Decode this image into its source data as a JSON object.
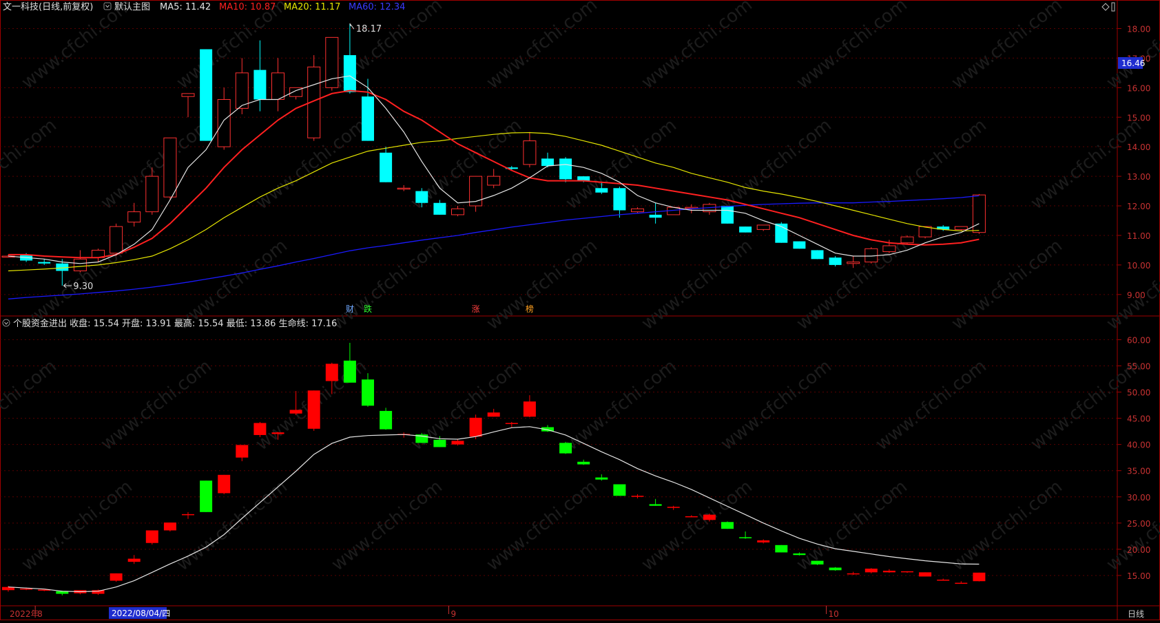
{
  "upper": {
    "stock_title": "文一科技(日线,前复权)",
    "indicator_name": "默认主图",
    "ma5_label": "MA5: 11.42",
    "ma10_label": "MA10: 10.87",
    "ma20_label": "MA20: 11.17",
    "ma60_label": "MA60: 12.34",
    "current_price_tag": "16.46",
    "high_label": "18.17",
    "low_label": "9.30",
    "diamond_icon": "diamond-icon",
    "colors": {
      "ma5": "#e6e6e6",
      "ma10": "#ff2020",
      "ma20": "#e6e600",
      "ma60": "#1a1aff",
      "up": "#ff3030",
      "down": "#00ffff"
    },
    "events": [
      {
        "index": 19,
        "text": "财",
        "color": "#6fa8ff"
      },
      {
        "index": 20,
        "text": "跌",
        "color": "#30ff30"
      },
      {
        "index": 26,
        "text": "涨",
        "color": "#ff4040"
      },
      {
        "index": 29,
        "text": "榜",
        "color": "#ffa020"
      }
    ]
  },
  "lower": {
    "indicator_label": "个股资金进出 收盘: 15.54 开盘: 13.91 最高: 15.54 最低: 13.86 生命线: 17.16",
    "colors": {
      "up": "#ff0000",
      "down": "#00ff00",
      "line": "#e6e6e6"
    }
  },
  "bottom_bar": {
    "year_label": "2022年",
    "date_cursor": "2022/08/04/四",
    "period_button": "日线",
    "months": [
      {
        "index": 2,
        "text": "8"
      },
      {
        "index": 25,
        "text": "9"
      },
      {
        "index": 46,
        "text": "10"
      }
    ]
  },
  "watermark": "www.cfchi.com",
  "chart_data": [
    {
      "type": "candlestick",
      "title": "文一科技(日线,前复权)",
      "y_axis_ticks": [
        9.0,
        10.0,
        11.0,
        12.0,
        13.0,
        14.0,
        15.0,
        16.0,
        17.0,
        18.0
      ],
      "ylim": [
        8.6,
        18.5
      ],
      "ohlc": [
        [
          10.3,
          10.35,
          10.25,
          10.3
        ],
        [
          10.35,
          10.4,
          10.1,
          10.15
        ],
        [
          10.1,
          10.2,
          10.0,
          10.05
        ],
        [
          10.05,
          10.2,
          9.3,
          9.8
        ],
        [
          9.8,
          10.5,
          9.75,
          10.2
        ],
        [
          10.25,
          10.55,
          10.1,
          10.5
        ],
        [
          10.4,
          11.4,
          10.3,
          11.3
        ],
        [
          11.45,
          12.1,
          11.3,
          11.8
        ],
        [
          11.8,
          13.3,
          11.7,
          13.0
        ],
        [
          12.3,
          14.3,
          12.2,
          14.3
        ],
        [
          15.7,
          15.75,
          15.0,
          15.8
        ],
        [
          17.3,
          17.3,
          14.2,
          14.2
        ],
        [
          14.0,
          16.0,
          13.9,
          15.6
        ],
        [
          15.3,
          17.0,
          15.1,
          16.5
        ],
        [
          16.6,
          17.6,
          15.2,
          15.6
        ],
        [
          15.6,
          17.0,
          15.2,
          16.5
        ],
        [
          15.7,
          16.0,
          15.6,
          16.0
        ],
        [
          14.3,
          17.1,
          14.2,
          16.7
        ],
        [
          16.0,
          17.7,
          15.9,
          17.7
        ],
        [
          17.1,
          18.17,
          15.8,
          15.85
        ],
        [
          15.7,
          16.3,
          14.2,
          14.2
        ],
        [
          13.8,
          14.0,
          12.8,
          12.8
        ],
        [
          12.6,
          12.7,
          12.5,
          12.6
        ],
        [
          12.5,
          12.6,
          11.95,
          12.1
        ],
        [
          12.1,
          12.2,
          11.7,
          11.7
        ],
        [
          11.7,
          12.0,
          11.65,
          11.9
        ],
        [
          12.0,
          13.0,
          11.8,
          13.0
        ],
        [
          12.7,
          13.25,
          12.6,
          13.0
        ],
        [
          13.3,
          13.35,
          13.2,
          13.25
        ],
        [
          13.4,
          14.5,
          13.3,
          14.2
        ],
        [
          13.6,
          13.8,
          13.3,
          13.35
        ],
        [
          13.6,
          13.65,
          12.8,
          12.9
        ],
        [
          13.0,
          13.0,
          12.8,
          12.85
        ],
        [
          12.6,
          12.8,
          12.4,
          12.45
        ],
        [
          12.6,
          12.65,
          11.6,
          11.85
        ],
        [
          11.8,
          11.95,
          11.75,
          11.9
        ],
        [
          11.7,
          12.1,
          11.4,
          11.6
        ],
        [
          11.7,
          11.95,
          11.7,
          11.95
        ],
        [
          11.95,
          12.05,
          11.75,
          11.95
        ],
        [
          11.8,
          12.1,
          11.7,
          12.05
        ],
        [
          12.0,
          12.0,
          11.4,
          11.4
        ],
        [
          11.3,
          11.3,
          11.1,
          11.1
        ],
        [
          11.2,
          11.35,
          11.15,
          11.35
        ],
        [
          11.4,
          11.45,
          10.75,
          10.75
        ],
        [
          10.8,
          10.8,
          10.55,
          10.55
        ],
        [
          10.5,
          10.5,
          10.2,
          10.2
        ],
        [
          10.25,
          10.3,
          9.95,
          10.0
        ],
        [
          10.05,
          10.3,
          9.9,
          10.1
        ],
        [
          10.1,
          10.6,
          10.05,
          10.55
        ],
        [
          10.45,
          10.85,
          10.4,
          10.65
        ],
        [
          10.75,
          11.0,
          10.7,
          10.95
        ],
        [
          10.95,
          11.3,
          10.9,
          11.3
        ],
        [
          11.3,
          11.35,
          11.15,
          11.2
        ],
        [
          11.2,
          11.3,
          11.15,
          11.3
        ],
        [
          11.1,
          12.4,
          11.05,
          12.37
        ]
      ],
      "ma5": [
        10.3,
        10.25,
        10.2,
        10.1,
        10.05,
        10.1,
        10.35,
        10.7,
        11.2,
        12.2,
        13.3,
        13.9,
        14.9,
        15.4,
        15.6,
        15.6,
        15.9,
        16.1,
        16.3,
        16.4,
        16.0,
        15.3,
        14.5,
        13.5,
        12.6,
        12.1,
        12.15,
        12.35,
        12.6,
        12.95,
        13.35,
        13.4,
        13.3,
        13.1,
        12.8,
        12.35,
        12.1,
        11.95,
        11.85,
        11.85,
        11.85,
        11.75,
        11.5,
        11.3,
        11.0,
        10.7,
        10.4,
        10.3,
        10.3,
        10.35,
        10.5,
        10.75,
        10.95,
        11.1,
        11.4
      ],
      "ma10": [
        10.35,
        10.35,
        10.3,
        10.27,
        10.25,
        10.25,
        10.35,
        10.6,
        10.9,
        11.4,
        12.0,
        12.6,
        13.3,
        13.9,
        14.4,
        14.9,
        15.3,
        15.55,
        15.8,
        15.9,
        15.85,
        15.6,
        15.2,
        14.9,
        14.5,
        14.1,
        13.8,
        13.5,
        13.2,
        12.95,
        12.85,
        12.85,
        12.85,
        12.8,
        12.75,
        12.7,
        12.6,
        12.5,
        12.4,
        12.3,
        12.2,
        12.05,
        11.9,
        11.75,
        11.6,
        11.4,
        11.2,
        11.0,
        10.85,
        10.75,
        10.7,
        10.68,
        10.7,
        10.75,
        10.87
      ],
      "ma20": [
        9.8,
        9.83,
        9.86,
        9.9,
        9.95,
        10.0,
        10.08,
        10.18,
        10.3,
        10.55,
        10.85,
        11.2,
        11.6,
        11.95,
        12.3,
        12.6,
        12.85,
        13.15,
        13.45,
        13.65,
        13.85,
        13.95,
        14.05,
        14.15,
        14.2,
        14.28,
        14.35,
        14.42,
        14.47,
        14.48,
        14.45,
        14.35,
        14.2,
        14.05,
        13.85,
        13.65,
        13.45,
        13.3,
        13.1,
        12.95,
        12.8,
        12.62,
        12.5,
        12.4,
        12.28,
        12.15,
        12.0,
        11.85,
        11.7,
        11.55,
        11.4,
        11.28,
        11.2,
        11.15,
        11.17
      ],
      "ma60": [
        8.85,
        8.9,
        8.94,
        8.98,
        9.02,
        9.07,
        9.12,
        9.18,
        9.25,
        9.33,
        9.42,
        9.52,
        9.62,
        9.73,
        9.85,
        9.97,
        10.1,
        10.22,
        10.35,
        10.48,
        10.58,
        10.66,
        10.75,
        10.84,
        10.92,
        11.0,
        11.1,
        11.19,
        11.28,
        11.36,
        11.44,
        11.52,
        11.58,
        11.64,
        11.7,
        11.75,
        11.8,
        11.85,
        11.9,
        11.94,
        11.98,
        12.02,
        12.05,
        12.07,
        12.09,
        12.1,
        12.1,
        12.1,
        12.13,
        12.15,
        12.18,
        12.21,
        12.24,
        12.28,
        12.34
      ]
    },
    {
      "type": "candlestick",
      "title": "个股资金进出",
      "y_axis_ticks": [
        15.0,
        20.0,
        25.0,
        30.0,
        35.0,
        40.0,
        45.0,
        50.0,
        55.0,
        60.0
      ],
      "ylim": [
        10.0,
        61.5
      ],
      "series": [
        {
          "name": "收盘",
          "ohlc": [
            [
              12.2,
              13.0,
              11.9,
              12.8
            ],
            [
              12.5,
              12.7,
              12.2,
              12.5
            ],
            [
              12.2,
              12.3,
              12.0,
              12.3
            ],
            [
              12.0,
              12.1,
              11.2,
              11.5
            ],
            [
              11.6,
              12.2,
              11.4,
              12.2
            ],
            [
              11.5,
              12.3,
              11.3,
              12.2
            ],
            [
              14.0,
              15.4,
              13.8,
              15.4
            ],
            [
              17.6,
              18.9,
              17.2,
              18.2
            ],
            [
              21.2,
              23.6,
              20.9,
              23.6
            ],
            [
              23.6,
              25.1,
              23.4,
              25.1
            ],
            [
              26.7,
              27.1,
              25.8,
              26.7
            ],
            [
              33.1,
              33.1,
              27.1,
              27.1
            ],
            [
              30.7,
              34.2,
              30.5,
              34.2
            ],
            [
              37.5,
              39.9,
              36.8,
              39.9
            ],
            [
              41.8,
              44.3,
              41.4,
              44.1
            ],
            [
              42.0,
              42.4,
              40.9,
              42.3
            ],
            [
              45.9,
              50.2,
              45.6,
              46.6
            ],
            [
              43.0,
              50.3,
              42.6,
              50.3
            ],
            [
              52.1,
              55.6,
              49.6,
              55.4
            ],
            [
              56.0,
              59.4,
              51.8,
              51.8
            ],
            [
              52.4,
              53.6,
              47.2,
              47.4
            ],
            [
              46.4,
              47.0,
              42.8,
              42.9
            ],
            [
              41.8,
              42.3,
              41.3,
              42.0
            ],
            [
              41.9,
              42.2,
              40.3,
              40.3
            ],
            [
              40.9,
              41.6,
              39.5,
              39.5
            ],
            [
              40.0,
              41.0,
              39.8,
              40.7
            ],
            [
              41.5,
              45.7,
              41.0,
              45.1
            ],
            [
              45.3,
              46.8,
              45.3,
              46.1
            ],
            [
              44.1,
              44.3,
              43.3,
              44.1
            ],
            [
              45.3,
              49.4,
              45.2,
              48.2
            ],
            [
              43.3,
              43.7,
              42.4,
              42.5
            ],
            [
              40.3,
              40.5,
              38.2,
              38.3
            ],
            [
              36.7,
              37.1,
              36.1,
              36.2
            ],
            [
              33.7,
              34.3,
              33.1,
              33.3
            ],
            [
              32.4,
              32.4,
              30.2,
              30.2
            ],
            [
              30.1,
              30.5,
              29.7,
              30.2
            ],
            [
              28.6,
              29.6,
              28.3,
              28.3
            ],
            [
              27.9,
              28.3,
              27.5,
              28.1
            ],
            [
              26.3,
              26.5,
              26.1,
              26.3
            ],
            [
              25.6,
              26.8,
              25.3,
              26.6
            ],
            [
              25.2,
              25.3,
              23.9,
              23.9
            ],
            [
              22.3,
              23.4,
              22.0,
              22.1
            ],
            [
              21.3,
              21.9,
              21.1,
              21.7
            ],
            [
              20.8,
              20.8,
              19.4,
              19.4
            ],
            [
              19.2,
              19.4,
              18.8,
              18.9
            ],
            [
              17.8,
              17.8,
              17.0,
              17.1
            ],
            [
              16.5,
              16.6,
              15.9,
              16.0
            ],
            [
              15.4,
              15.7,
              15.1,
              15.4
            ],
            [
              15.6,
              16.4,
              15.4,
              16.3
            ],
            [
              15.6,
              16.2,
              15.5,
              15.9
            ],
            [
              15.7,
              15.8,
              15.5,
              15.8
            ],
            [
              14.8,
              15.6,
              14.8,
              15.6
            ],
            [
              14.2,
              14.4,
              14.0,
              14.2
            ],
            [
              13.6,
              13.9,
              13.6,
              13.6
            ],
            [
              13.91,
              15.54,
              13.86,
              15.54
            ]
          ]
        },
        {
          "name": "生命线",
          "values": [
            12.8,
            12.6,
            12.4,
            12.0,
            11.9,
            12.0,
            12.8,
            14.0,
            15.6,
            17.2,
            18.7,
            20.4,
            22.8,
            25.9,
            28.9,
            31.9,
            34.9,
            38.1,
            40.2,
            41.4,
            41.7,
            41.8,
            41.9,
            41.6,
            41.1,
            41.0,
            41.5,
            42.4,
            43.2,
            43.4,
            42.8,
            41.8,
            40.2,
            38.6,
            37.1,
            35.4,
            34.0,
            32.8,
            31.4,
            29.8,
            28.2,
            26.6,
            25.0,
            23.5,
            22.1,
            21.0,
            20.1,
            19.6,
            19.1,
            18.6,
            18.2,
            17.8,
            17.5,
            17.2,
            17.16
          ]
        }
      ]
    }
  ]
}
